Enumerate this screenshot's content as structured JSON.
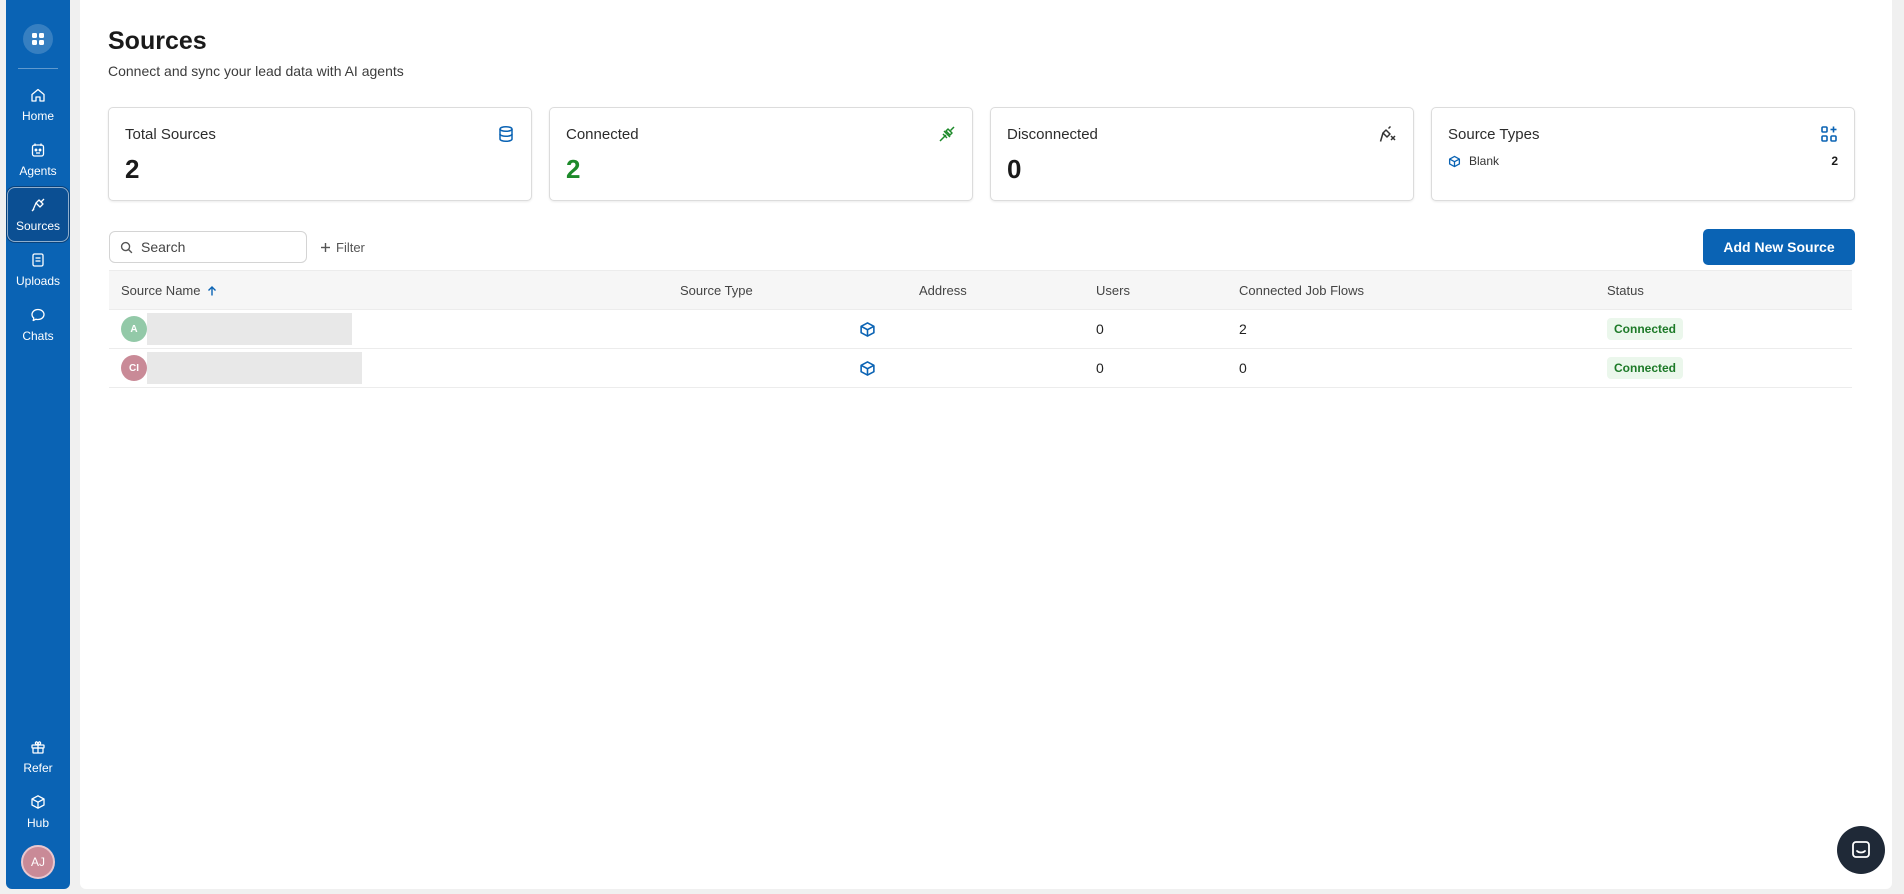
{
  "sidebar": {
    "logo_icon": "grid-icon",
    "items": [
      {
        "label": "Home",
        "icon": "home-icon",
        "active": false
      },
      {
        "label": "Agents",
        "icon": "agents-icon",
        "active": false
      },
      {
        "label": "Sources",
        "icon": "plug-icon",
        "active": true
      },
      {
        "label": "Uploads",
        "icon": "document-icon",
        "active": false
      },
      {
        "label": "Chats",
        "icon": "chat-icon",
        "active": false
      }
    ],
    "bottom_items": [
      {
        "label": "Refer",
        "icon": "gift-icon"
      },
      {
        "label": "Hub",
        "icon": "cube-icon"
      }
    ],
    "user_initials": "AJ"
  },
  "page": {
    "title": "Sources",
    "subtitle": "Connect and sync your lead data with AI agents"
  },
  "cards": {
    "total": {
      "label": "Total Sources",
      "value": "2",
      "icon": "database-icon"
    },
    "connected": {
      "label": "Connected",
      "value": "2",
      "icon": "plug-connected-icon"
    },
    "disconnected": {
      "label": "Disconnected",
      "value": "0",
      "icon": "plug-disconnected-icon"
    },
    "source_types": {
      "label": "Source Types",
      "icon": "add-grid-icon",
      "type_name": "Blank",
      "type_count": "2"
    }
  },
  "toolbar": {
    "search_placeholder": "Search",
    "filter_label": "Filter",
    "add_label": "Add New Source"
  },
  "table": {
    "columns": {
      "name": "Source Name",
      "type": "Source Type",
      "address": "Address",
      "users": "Users",
      "flows": "Connected Job Flows",
      "status": "Status"
    },
    "rows": [
      {
        "initials": "A",
        "avatar_color": "#93c9a8",
        "users": "0",
        "flows": "2",
        "status": "Connected"
      },
      {
        "initials": "CI",
        "avatar_color": "#c98a97",
        "users": "0",
        "flows": "0",
        "status": "Connected"
      }
    ]
  },
  "colors": {
    "brand": "#0a63b4",
    "connected_green": "#1d8a2a"
  }
}
